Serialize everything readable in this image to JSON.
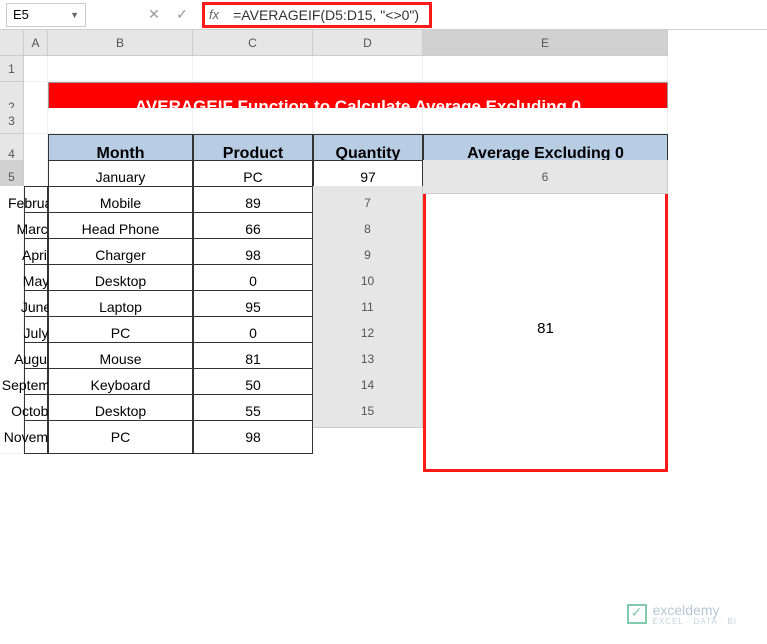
{
  "namebox": {
    "cell_ref": "E5"
  },
  "formula_bar": {
    "formula": "=AVERAGEIF(D5:D15, \"<>0\")"
  },
  "col_headers": [
    "A",
    "B",
    "C",
    "D",
    "E"
  ],
  "row_headers": [
    "1",
    "2",
    "3",
    "4",
    "5",
    "6",
    "7",
    "8",
    "9",
    "10",
    "11",
    "12",
    "13",
    "14",
    "15"
  ],
  "title": "AVERAGEIF Function to Calculate Average Excluding 0",
  "table": {
    "headers": {
      "month": "Month",
      "product": "Product",
      "quantity": "Quantity",
      "avg": "Average Excluding 0"
    },
    "rows": [
      {
        "month": "January",
        "product": "PC",
        "quantity": "97"
      },
      {
        "month": "February",
        "product": "Mobile",
        "quantity": "89"
      },
      {
        "month": "March",
        "product": "Head Phone",
        "quantity": "66"
      },
      {
        "month": "April",
        "product": "Charger",
        "quantity": "98"
      },
      {
        "month": "May",
        "product": "Desktop",
        "quantity": "0"
      },
      {
        "month": "June",
        "product": "Laptop",
        "quantity": "95"
      },
      {
        "month": "July",
        "product": "PC",
        "quantity": "0"
      },
      {
        "month": "August",
        "product": "Mouse",
        "quantity": "81"
      },
      {
        "month": "September",
        "product": "Keyboard",
        "quantity": "50"
      },
      {
        "month": "October",
        "product": "Desktop",
        "quantity": "55"
      },
      {
        "month": "November",
        "product": "PC",
        "quantity": "98"
      }
    ],
    "average": "81"
  },
  "watermark": {
    "brand": "exceldemy",
    "tagline": "EXCEL · DATA · BI"
  }
}
